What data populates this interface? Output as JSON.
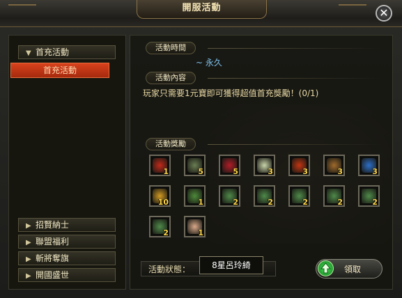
{
  "window": {
    "title": "開服活動"
  },
  "sidebar": {
    "top_item": {
      "label": "首充活動",
      "arrow": "▼"
    },
    "sub_item": {
      "label": "首充活動"
    },
    "bottom_items": [
      {
        "label": "招賢納士",
        "arrow": "▶"
      },
      {
        "label": "聯盟福利",
        "arrow": "▶"
      },
      {
        "label": "斬將奪旗",
        "arrow": "▶"
      },
      {
        "label": "開國盛世",
        "arrow": "▶"
      }
    ]
  },
  "activity": {
    "time_title": "活動時間",
    "time_value": "~ 永久",
    "content_title": "活動內容",
    "content_value": "玩家只需要1元寶即可獲得超值首充獎勵！(0/1)",
    "rewards_title": "活動獎勵"
  },
  "rewards": [
    {
      "icon": "red-banner-icon",
      "count": "1",
      "color": "#c22a1a"
    },
    {
      "icon": "jade-disc-icon",
      "count": "5",
      "color": "#6a7d52"
    },
    {
      "icon": "red-scroll-card-icon",
      "count": "5",
      "color": "#b11d28"
    },
    {
      "icon": "wine-jar-icon",
      "count": "3",
      "color": "#c8d4a8"
    },
    {
      "icon": "red-seal-icon",
      "count": "3",
      "color": "#c23512"
    },
    {
      "icon": "wooden-plank-icon",
      "count": "3",
      "color": "#a06a2c"
    },
    {
      "icon": "blue-token-icon",
      "count": "3",
      "color": "#2d6fc8"
    },
    {
      "icon": "gold-bracelet-icon",
      "count": "10",
      "color": "#d29a22"
    },
    {
      "icon": "bonsai-tree-icon",
      "count": "1",
      "color": "#4d8a3a"
    },
    {
      "icon": "green-scroll-icon",
      "count": "2",
      "color": "#4f8a4a"
    },
    {
      "icon": "green-scroll-icon",
      "count": "2",
      "color": "#4f8a4a"
    },
    {
      "icon": "green-scroll-icon",
      "count": "2",
      "color": "#4f8a4a"
    },
    {
      "icon": "green-scroll-icon",
      "count": "2",
      "color": "#4f8a4a"
    },
    {
      "icon": "green-scroll-icon",
      "count": "2",
      "color": "#4f8a4a"
    },
    {
      "icon": "green-scroll-icon",
      "count": "2",
      "color": "#4f8a4a"
    },
    {
      "icon": "general-portrait-icon",
      "count": "1",
      "color": "#d9a98a"
    }
  ],
  "status": {
    "label": "活動狀態：",
    "value": "8星呂玲綺"
  },
  "claim_button": {
    "label": "領取"
  },
  "close_button": {
    "label": "✕"
  }
}
